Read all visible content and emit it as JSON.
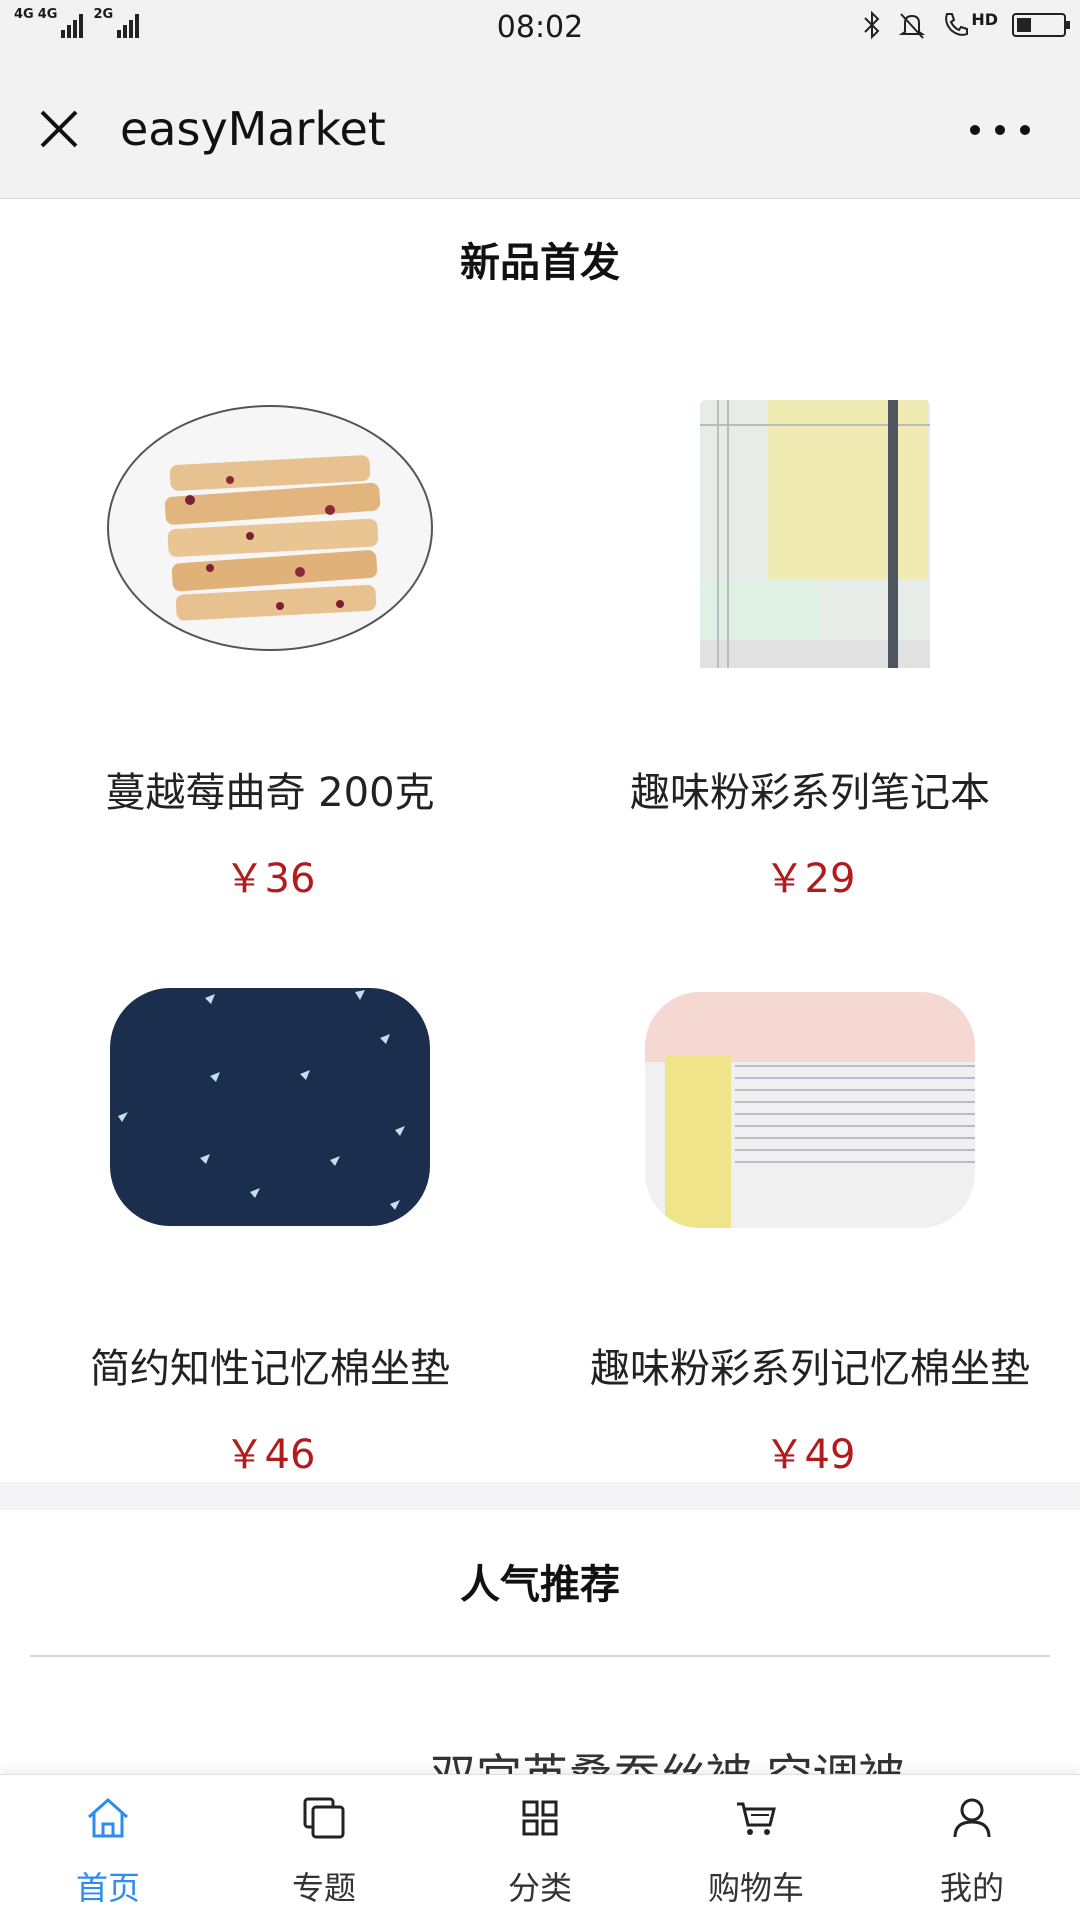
{
  "status_bar": {
    "network_1": "4G",
    "network_2": "4G",
    "network_3": "2G",
    "time": "08:02",
    "hd_label": "HD"
  },
  "header": {
    "title": "easyMarket",
    "close_icon": "close-icon",
    "more_icon": "more-horizontal-icon"
  },
  "new_products": {
    "title": "新品首发",
    "items": [
      {
        "name": "蔓越莓曲奇 200克",
        "price": "￥36",
        "image": "cranberry-cookie-plate"
      },
      {
        "name": "趣味粉彩系列笔记本",
        "price": "￥29",
        "image": "pastel-notebook"
      },
      {
        "name": "简约知性记忆棉坐垫",
        "price": "￥46",
        "image": "navy-triangle-cushion"
      },
      {
        "name": "趣味粉彩系列记忆棉坐垫",
        "price": "￥49",
        "image": "pastel-stripe-cushion"
      }
    ]
  },
  "popular": {
    "title": "人气推荐",
    "first_item_partial": "双宫茧桑蚕丝被 空调被"
  },
  "tab_bar": {
    "tabs": [
      {
        "label": "首页",
        "icon": "home-icon",
        "active": true
      },
      {
        "label": "专题",
        "icon": "topic-icon",
        "active": false
      },
      {
        "label": "分类",
        "icon": "category-grid-icon",
        "active": false
      },
      {
        "label": "购物车",
        "icon": "cart-icon",
        "active": false
      },
      {
        "label": "我的",
        "icon": "user-icon",
        "active": false
      }
    ]
  },
  "colors": {
    "accent": "#2d8cf0",
    "price": "#b01b1b",
    "header_bg": "#f2f2f2"
  }
}
